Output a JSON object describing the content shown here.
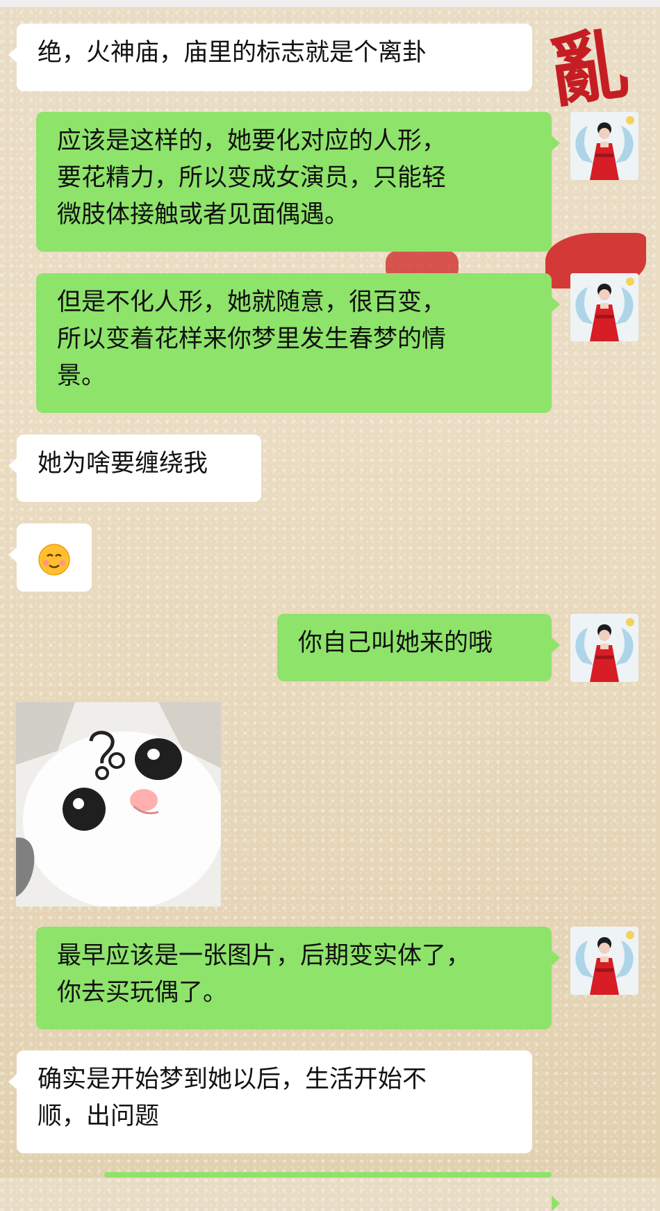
{
  "chat": {
    "messages": [
      {
        "side": "left",
        "text": "绝，火神庙，庙里的标志就是个离卦"
      },
      {
        "side": "right",
        "text": "应该是这样的，她要化对应的人形，\n要花精力，所以变成女演员，只能轻\n微肢体接触或者见面偶遇。"
      },
      {
        "side": "right",
        "text": "但是不化人形，她就随意，很百变，\n所以变着花样来你梦里发生春梦的情\n景。"
      },
      {
        "side": "left",
        "text": "她为啥要缠绕我"
      },
      {
        "side": "left",
        "type": "emoji",
        "emoji_name": "smiling-face-emoji"
      },
      {
        "side": "right",
        "text": "你自己叫她来的哦"
      },
      {
        "side": "left",
        "type": "sticker",
        "sticker_name": "cat-question-sticker"
      },
      {
        "side": "right",
        "text": "最早应该是一张图片，后期变实体了，\n你去买玩偶了。"
      },
      {
        "side": "left",
        "text": "确实是开始梦到她以后，生活开始不\n顺，出问题"
      }
    ]
  },
  "colors": {
    "incoming_bubble": "#ffffff",
    "outgoing_bubble": "#8ee36b",
    "background": "#e8d9bf",
    "decor_red": "#c3141b"
  },
  "avatar": {
    "name": "avatar-red-dress-icon"
  }
}
